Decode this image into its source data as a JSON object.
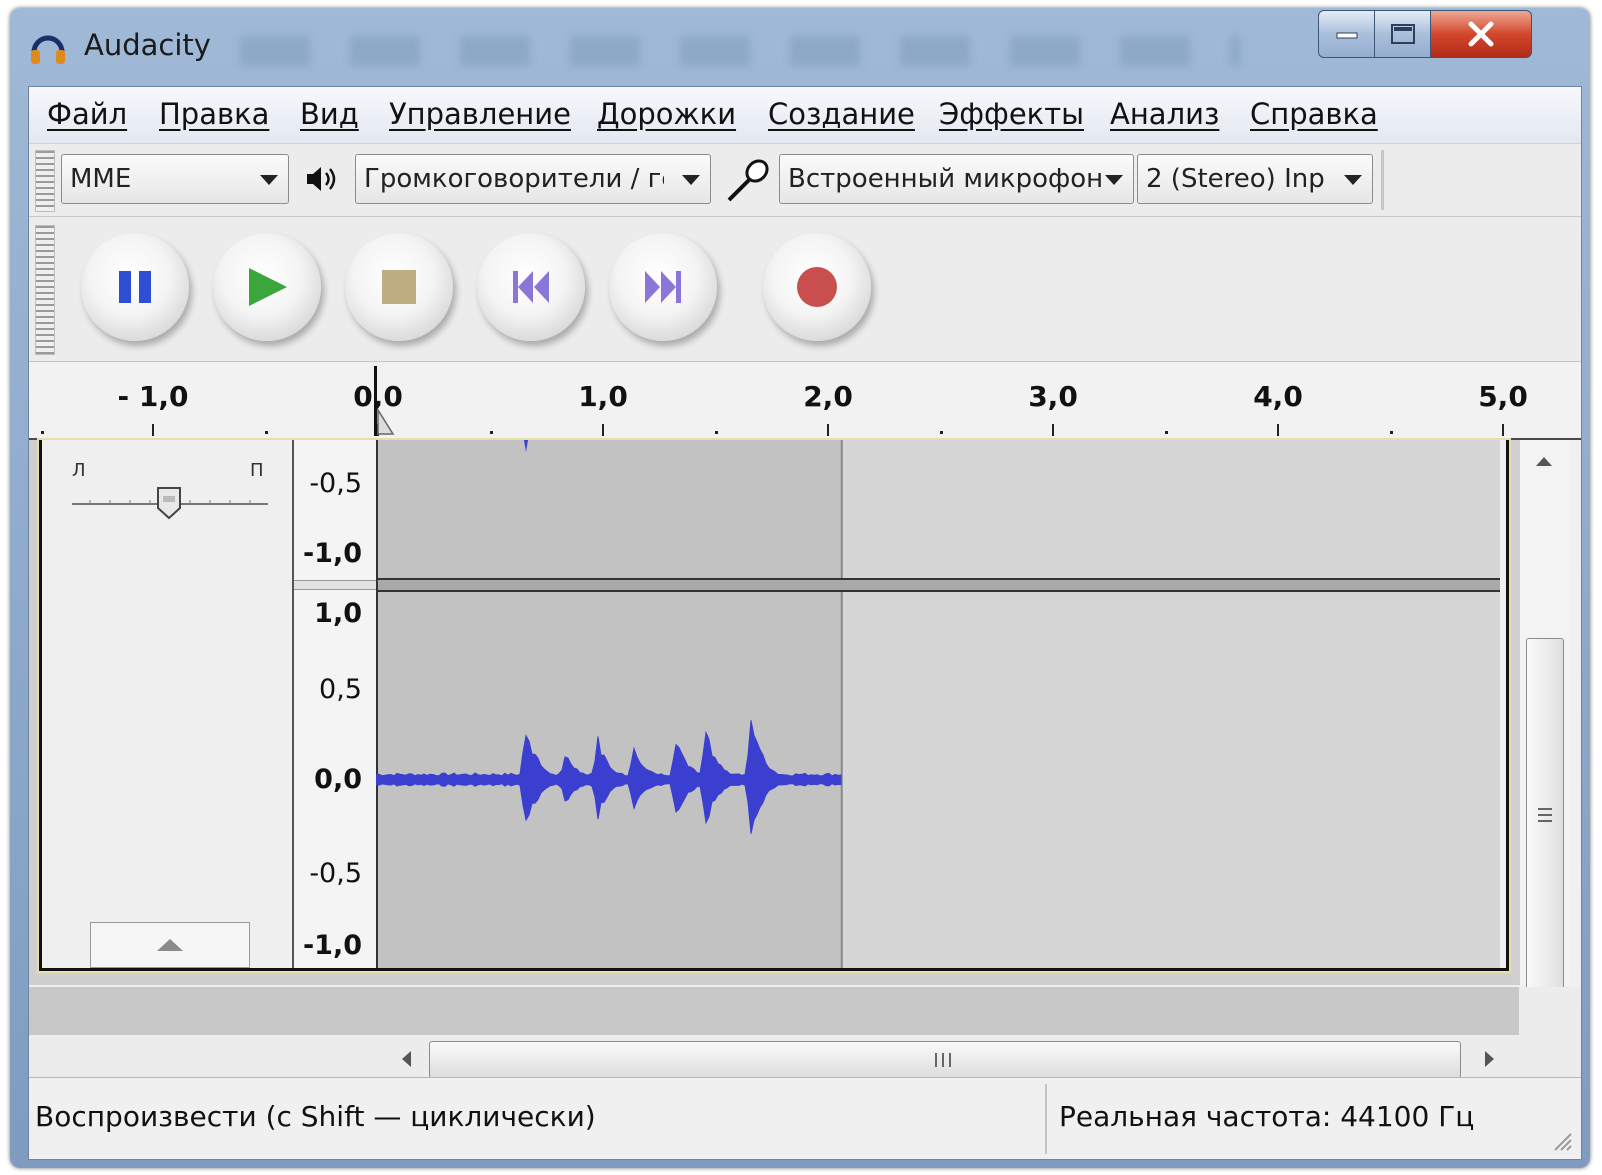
{
  "window": {
    "title": "Audacity",
    "controls": {
      "minimize_icon": "minimize-icon",
      "maximize_icon": "maximize-icon",
      "close_icon": "close-icon"
    }
  },
  "menu": [
    "Файл",
    "Правка",
    "Вид",
    "Управление",
    "Дорожки",
    "Создание",
    "Эффекты",
    "Анализ",
    "Справка"
  ],
  "device_toolbar": {
    "host": "MME",
    "output_device": "Громкоговорители / гс",
    "input_device": "Встроенный микрофон",
    "input_channels": "2 (Stereo) Inp"
  },
  "transport": {
    "buttons": [
      "pause",
      "play",
      "stop",
      "skip-to-start",
      "skip-to-end",
      "record"
    ],
    "colors": {
      "pause": "#2c4fd6",
      "play": "#3aa63c",
      "stop": "#bfae82",
      "skip": "#8a76d6",
      "record": "#c94f4f"
    }
  },
  "timeline": {
    "labels": [
      "- 1,0",
      "0,0",
      "1,0",
      "2,0",
      "3,0",
      "4,0",
      "5,0"
    ],
    "values": [
      -1.0,
      0.0,
      1.0,
      2.0,
      3.0,
      4.0,
      5.0
    ],
    "playhead_seconds": 0.0
  },
  "track": {
    "pan_left_label": "Л",
    "pan_right_label": "П",
    "scale_top": [
      "-0,5",
      "-1,0"
    ],
    "scale_bottom": [
      "1,0",
      "0,5",
      "0,0",
      "-0,5",
      "-1,0"
    ],
    "clip_end_seconds": 2.07,
    "waveform_color": "#3a3fd0",
    "clip_color": "#c2c2c2",
    "empty_color": "#d6d6d6"
  },
  "status": {
    "hint": "Воспроизвести (с Shift — циклически)",
    "rate": "Реальная частота: 44100 Гц"
  }
}
